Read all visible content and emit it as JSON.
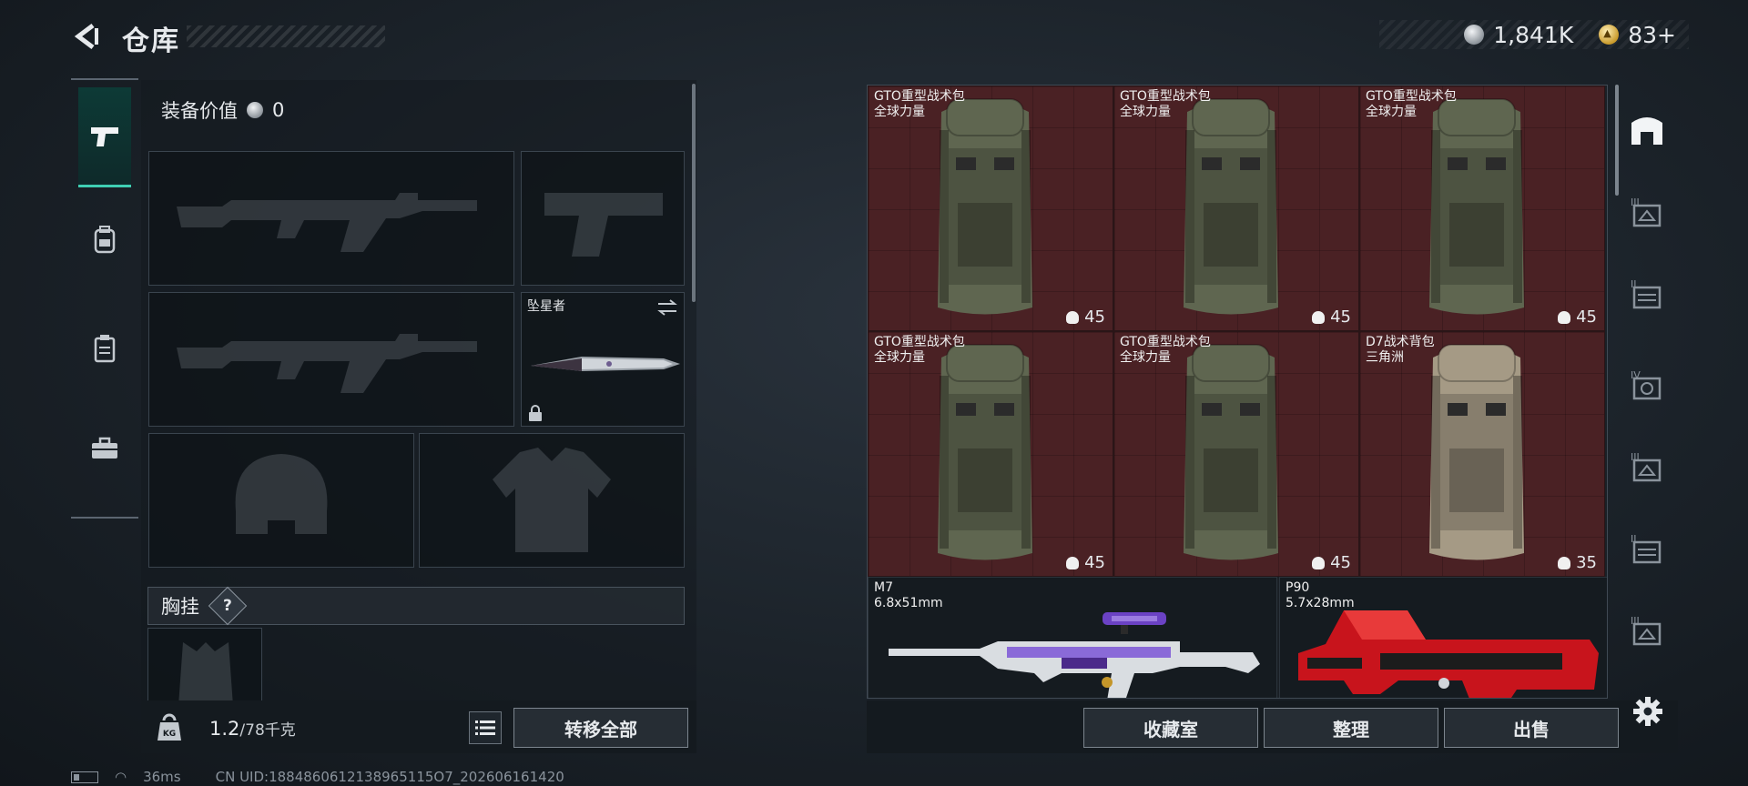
{
  "header": {
    "title": "仓库",
    "currency_silver": "1,841K",
    "currency_gold": "83+"
  },
  "loadout": {
    "equip_value_label": "装备价值",
    "equip_value": "0",
    "knife_name": "坠星者",
    "chest_rig_label": "胸挂",
    "chest_rig_help": "?",
    "weight_current": "1.2",
    "weight_max": "/78千克",
    "transfer_all": "转移全部"
  },
  "inventory": {
    "items": [
      {
        "name": "GTO重型战术包",
        "subtitle": "全球力量",
        "count": "45",
        "tint": "#5f6650"
      },
      {
        "name": "GTO重型战术包",
        "subtitle": "全球力量",
        "count": "45",
        "tint": "#5f6650"
      },
      {
        "name": "GTO重型战术包",
        "subtitle": "全球力量",
        "count": "45",
        "tint": "#5f6650"
      },
      {
        "name": "GTO重型战术包",
        "subtitle": "全球力量",
        "count": "45",
        "tint": "#5f6650"
      },
      {
        "name": "GTO重型战术包",
        "subtitle": "全球力量",
        "count": "45",
        "tint": "#5f6650"
      },
      {
        "name": "D7战术背包",
        "subtitle": "三角洲",
        "count": "35",
        "tint": "#a59a85"
      }
    ],
    "guns": [
      {
        "name": "M7",
        "caliber": "6.8x51mm"
      },
      {
        "name": "P90",
        "caliber": "5.7x28mm"
      }
    ]
  },
  "actions": {
    "collection": "收藏室",
    "organize": "整理",
    "sell": "出售"
  },
  "side_tabs": [
    "building-icon",
    "box-III-icon",
    "box-II-icon",
    "box-IV-icon",
    "box-III-icon",
    "box-II-icon",
    "box-III-icon"
  ],
  "status": {
    "ping": "36ms",
    "uid": "CN UID:1884860612138965115O7_202606161420"
  },
  "colors": {
    "accent": "#3fcfb3",
    "item_bg": "#4a2124"
  }
}
